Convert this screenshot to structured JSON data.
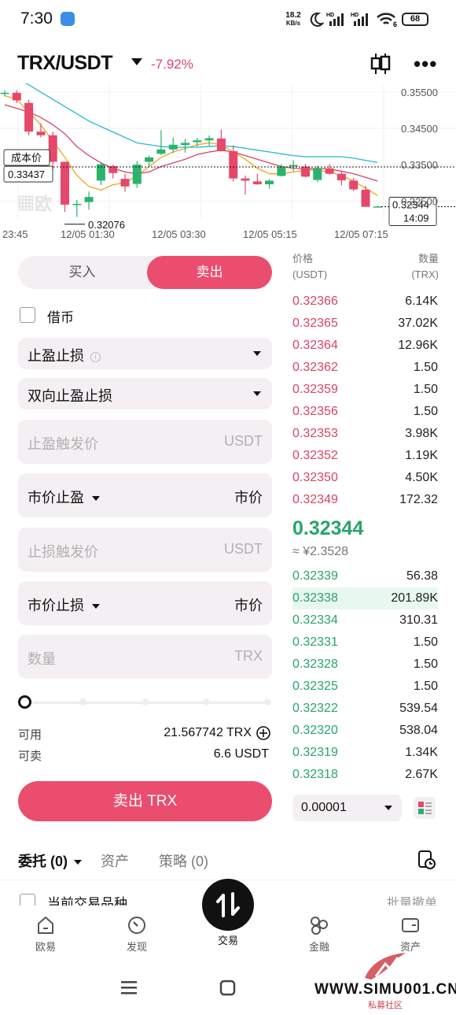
{
  "status_bar": {
    "time": "7:30",
    "net_speed": "18.2",
    "net_unit": "KB/s",
    "battery": "68",
    "wifi_badge": "6"
  },
  "header": {
    "pair": "TRX/USDT",
    "change": "-7.92%",
    "icons": [
      "candlestick-icon",
      "more-icon"
    ]
  },
  "chart_data": {
    "type": "candlestick",
    "x_ticks": [
      "23:45",
      "12/05 01:30",
      "12/05 03:30",
      "12/05 05:15",
      "12/05 07:15"
    ],
    "y_ticks": [
      "0.35500",
      "0.34500",
      "0.33500",
      "0.32500"
    ],
    "ylim": [
      0.3205,
      0.3565
    ],
    "cost_label": "成本价",
    "cost_price": "0.33437",
    "low_marker": "0.32076",
    "last_price": "0.32344",
    "countdown": "14:09",
    "watermark": "欧",
    "up_color": "#2ab36b",
    "down_color": "#e5486a",
    "candles": [
      [
        0.3545,
        0.3555,
        0.3538,
        0.3548
      ],
      [
        0.3548,
        0.3555,
        0.352,
        0.3527
      ],
      [
        0.352,
        0.3529,
        0.3431,
        0.3441
      ],
      [
        0.3441,
        0.3464,
        0.3425,
        0.3431
      ],
      [
        0.3431,
        0.3441,
        0.3335,
        0.3358
      ],
      [
        0.3358,
        0.3358,
        0.322,
        0.324
      ],
      [
        0.324,
        0.3253,
        0.3206,
        0.3242
      ],
      [
        0.3247,
        0.3276,
        0.3226,
        0.3261
      ],
      [
        0.3306,
        0.3356,
        0.3294,
        0.3351
      ],
      [
        0.3346,
        0.335,
        0.3312,
        0.3327
      ],
      [
        0.3311,
        0.3325,
        0.3276,
        0.329
      ],
      [
        0.3297,
        0.336,
        0.3286,
        0.335
      ],
      [
        0.3358,
        0.3375,
        0.3347,
        0.337
      ],
      [
        0.338,
        0.3445,
        0.3376,
        0.3392
      ],
      [
        0.3392,
        0.3425,
        0.3382,
        0.3405
      ],
      [
        0.3404,
        0.3421,
        0.3383,
        0.341
      ],
      [
        0.3412,
        0.3424,
        0.34,
        0.3417
      ],
      [
        0.3417,
        0.3431,
        0.3402,
        0.3423
      ],
      [
        0.3422,
        0.3447,
        0.3387,
        0.3387
      ],
      [
        0.3387,
        0.3403,
        0.3304,
        0.3312
      ],
      [
        0.3312,
        0.332,
        0.3268,
        0.3306
      ],
      [
        0.3304,
        0.3325,
        0.3295,
        0.3296
      ],
      [
        0.3296,
        0.331,
        0.3284,
        0.3306
      ],
      [
        0.3319,
        0.3352,
        0.3317,
        0.3345
      ],
      [
        0.3345,
        0.3362,
        0.3332,
        0.3349
      ],
      [
        0.3345,
        0.3352,
        0.3315,
        0.3317
      ],
      [
        0.3308,
        0.3347,
        0.3302,
        0.334
      ],
      [
        0.334,
        0.3351,
        0.3322,
        0.3325
      ],
      [
        0.3325,
        0.333,
        0.3293,
        0.3307
      ],
      [
        0.3306,
        0.3314,
        0.3277,
        0.3282
      ],
      [
        0.3281,
        0.3292,
        0.3234,
        0.3234
      ],
      [
        0.3234,
        0.3237,
        0.3232,
        0.3235
      ]
    ],
    "ma_lines": [
      {
        "color": "#f2a41e",
        "values": [
          0.354,
          0.353,
          0.3495,
          0.346,
          0.3415,
          0.337,
          0.332,
          0.329,
          0.328,
          0.3295,
          0.33,
          0.332,
          0.3345,
          0.337,
          0.3385,
          0.3395,
          0.3405,
          0.341,
          0.3405,
          0.3385,
          0.3365,
          0.334,
          0.3325,
          0.3325,
          0.333,
          0.3335,
          0.3335,
          0.333,
          0.332,
          0.3305,
          0.3285,
          0.3265
        ]
      },
      {
        "color": "#d4456e",
        "values": [
          0.3515,
          0.3505,
          0.3495,
          0.348,
          0.346,
          0.3435,
          0.34,
          0.3375,
          0.3355,
          0.334,
          0.333,
          0.3325,
          0.333,
          0.3345,
          0.3355,
          0.3365,
          0.3378,
          0.3385,
          0.339,
          0.3385,
          0.3375,
          0.3365,
          0.3355,
          0.3345,
          0.334,
          0.3338,
          0.334,
          0.3338,
          0.3332,
          0.3325,
          0.3315,
          0.3305
        ]
      },
      {
        "color": "#28b8d0",
        "values": [
          0.36,
          0.3585,
          0.357,
          0.355,
          0.353,
          0.351,
          0.349,
          0.347,
          0.3455,
          0.344,
          0.3425,
          0.341,
          0.3405,
          0.34,
          0.3398,
          0.3398,
          0.3398,
          0.34,
          0.3402,
          0.34,
          0.3395,
          0.339,
          0.3385,
          0.338,
          0.3375,
          0.3372,
          0.3372,
          0.3372,
          0.3372,
          0.3368,
          0.3362,
          0.3356
        ]
      }
    ]
  },
  "trade_panel": {
    "buy_label": "买入",
    "sell_label": "卖出",
    "borrow_label": "借币",
    "order_type": "止盈止损",
    "tpsl_mode": "双向止盈止损",
    "tp_trigger_placeholder": "止盈触发价",
    "tp_trigger_unit": "USDT",
    "tp_type": "市价止盈",
    "tp_price": "市价",
    "sl_trigger_placeholder": "止损触发价",
    "sl_trigger_unit": "USDT",
    "sl_type": "市价止损",
    "sl_price": "市价",
    "amount_placeholder": "数量",
    "amount_unit": "TRX",
    "available_label": "可用",
    "available_value": "21.567742 TRX",
    "sellable_label": "可卖",
    "sellable_value": "6.6 USDT",
    "submit_label": "卖出 TRX"
  },
  "order_book": {
    "price_header": "价格",
    "price_unit": "(USDT)",
    "qty_header": "数量",
    "qty_unit": "(TRX)",
    "asks": [
      {
        "price": "0.32366",
        "qty": "6.14K"
      },
      {
        "price": "0.32365",
        "qty": "37.02K"
      },
      {
        "price": "0.32364",
        "qty": "12.96K"
      },
      {
        "price": "0.32362",
        "qty": "1.50"
      },
      {
        "price": "0.32359",
        "qty": "1.50"
      },
      {
        "price": "0.32356",
        "qty": "1.50"
      },
      {
        "price": "0.32353",
        "qty": "3.98K"
      },
      {
        "price": "0.32352",
        "qty": "1.19K"
      },
      {
        "price": "0.32350",
        "qty": "4.50K"
      },
      {
        "price": "0.32349",
        "qty": "172.32"
      }
    ],
    "last_price": "0.32344",
    "last_cny": "≈ ¥2.3528",
    "bids": [
      {
        "price": "0.32339",
        "qty": "56.38"
      },
      {
        "price": "0.32338",
        "qty": "201.89K"
      },
      {
        "price": "0.32334",
        "qty": "310.31"
      },
      {
        "price": "0.32331",
        "qty": "1.50"
      },
      {
        "price": "0.32328",
        "qty": "1.50"
      },
      {
        "price": "0.32325",
        "qty": "1.50"
      },
      {
        "price": "0.32322",
        "qty": "539.54"
      },
      {
        "price": "0.32320",
        "qty": "538.04"
      },
      {
        "price": "0.32319",
        "qty": "1.34K"
      },
      {
        "price": "0.32318",
        "qty": "2.67K"
      }
    ],
    "step": "0.00001"
  },
  "orders": {
    "tab_orders": "委托 (0)",
    "tab_assets": "资产",
    "tab_strategy": "策略 (0)",
    "current_pair_only": "当前交易品种",
    "batch_cancel": "批量撤单"
  },
  "bottom_nav": [
    {
      "label": "欧易",
      "icon": "home-icon"
    },
    {
      "label": "发现",
      "icon": "discover-icon"
    },
    {
      "label": "交易",
      "icon": "trade-icon"
    },
    {
      "label": "金融",
      "icon": "finance-icon"
    },
    {
      "label": "资产",
      "icon": "wallet-icon"
    }
  ],
  "watermark": {
    "site": "WWW.SIMU001.CN",
    "sub": "私募社区"
  }
}
